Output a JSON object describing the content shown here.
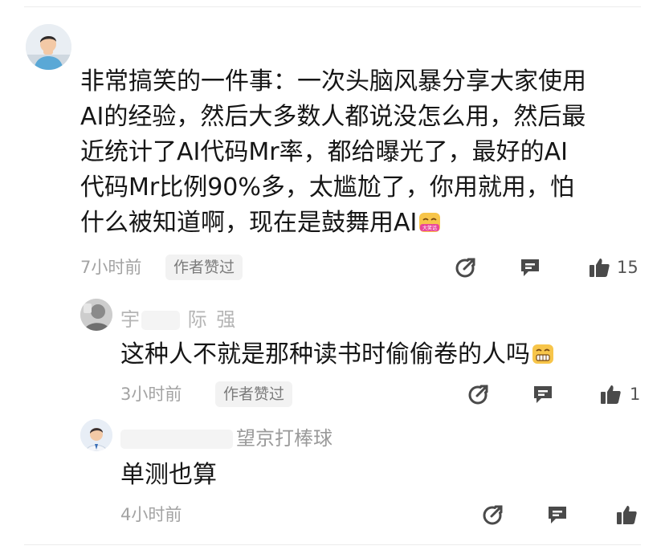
{
  "comments": [
    {
      "text": "非常搞笑的一件事：一次头脑风暴分享大家使用AI的经验，然后大多数人都说没怎么用，然后最近统计了AI代码Mr率，都给曝光了，最好的AI代码Mr比例90%多，太尴尬了，你用就用，怕什么被知道啊，现在是鼓舞用AI",
      "lines": [
        "非常搞笑的一件事：一次头脑风暴分享大家使用",
        "AI的经验，然后大多数人都说没怎么用，然后最",
        "近统计了AI代码Mr率，都给曝光了，最好的AI",
        "代码Mr比例90%多，太尴尬了，你用就用，怕",
        "什么被知道啊，现在是鼓舞用AI"
      ],
      "time": "7小时前",
      "badge": "作者赞过",
      "likes": "15",
      "emoji_text": "大笑话"
    },
    {
      "name_a": "宇",
      "name_b": "际",
      "name_c": "强",
      "text": "这种人不就是那种读书时偷偷卷的人吗",
      "time": "3小时前",
      "badge": "作者赞过",
      "likes": "1"
    },
    {
      "name_suffix": "望京打棒球",
      "text": "单测也算",
      "time": "4小时前"
    }
  ],
  "icons": {
    "share": "share-icon",
    "reply": "reply-icon",
    "like": "thumbs-up-icon"
  },
  "colors": {
    "meta_text": "#a3a3a3",
    "icon": "#4a4a4a",
    "emoji": "#f6c343"
  }
}
